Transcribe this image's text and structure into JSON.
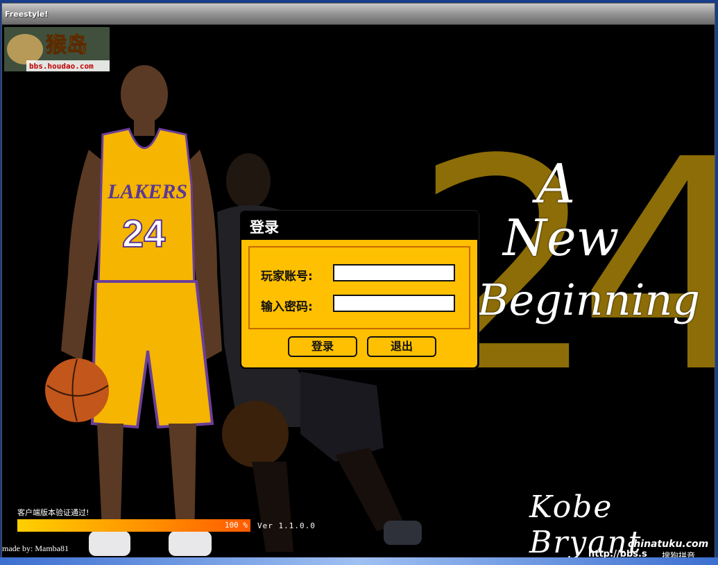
{
  "window": {
    "title": "Freestyle!"
  },
  "logo": {
    "main_text": "猴岛",
    "url_text": "bbs.houdao.com"
  },
  "background": {
    "big_number": "24",
    "script_line1": "A",
    "script_line2": "New",
    "script_line3": "Beginning",
    "signature": "Kobe Bryant",
    "jersey_brand": "LAKERS",
    "jersey_number": "24"
  },
  "login": {
    "title": "登录",
    "account_label": "玩家账号:",
    "account_value": "",
    "password_label": "输入密码:",
    "password_value": "",
    "login_button": "登录",
    "exit_button": "退出"
  },
  "status": {
    "message": "客户端版本验证通过!",
    "progress_percent": 100,
    "progress_label": "100 %",
    "version": "Ver 1.1.0.0",
    "made_by": "made by: Mamba81"
  },
  "watermark": {
    "site": "chinatuku.com",
    "url": "http://bbs.s",
    "ime": "搜狗拼音"
  },
  "colors": {
    "panel_yellow": "#fec000",
    "gold_24": "#8c6d07",
    "progress_start": "#ffd000",
    "progress_end": "#ff5a00"
  }
}
